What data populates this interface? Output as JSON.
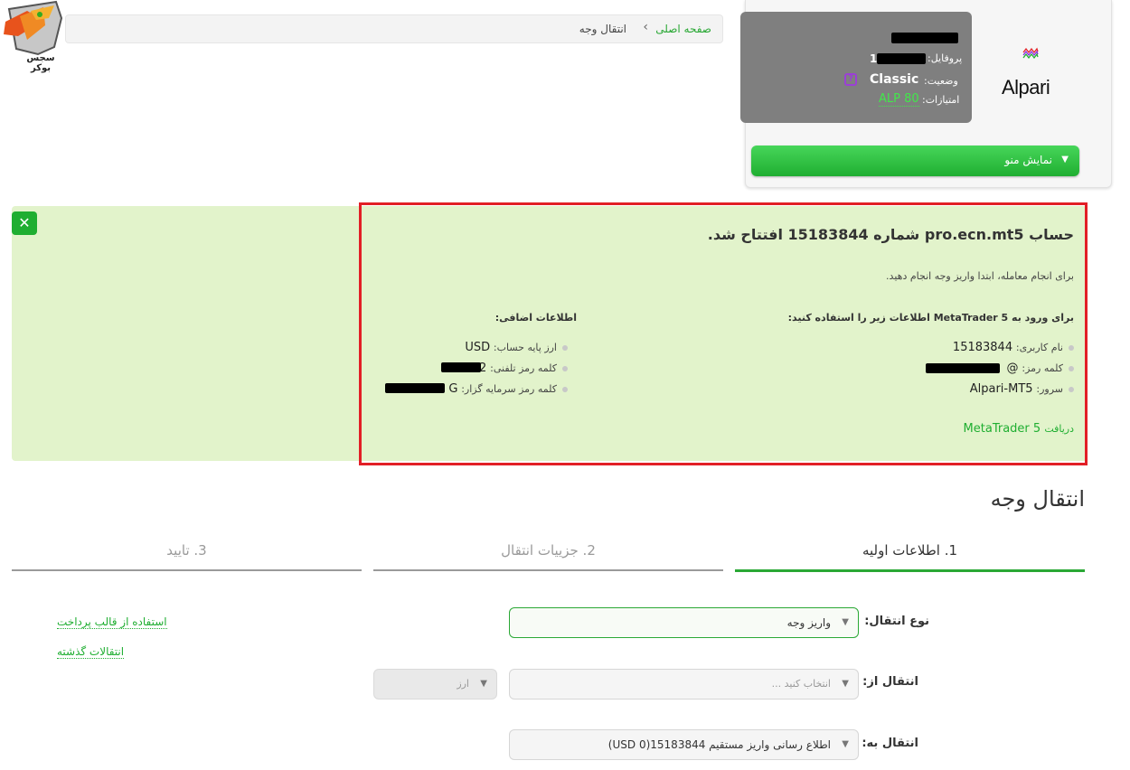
{
  "site": {
    "logo_text": "سجس بوکر"
  },
  "breadcrumb": {
    "home": "صفحه اصلی",
    "separator": "›",
    "current": "انتقال وجه"
  },
  "profile": {
    "profile_label": "پروفایل:",
    "profile_value_visible": "1",
    "status_label": "وضعیت:",
    "status_value": "Classic",
    "help_icon_glyph": "?",
    "points_label": "امتیازات:",
    "points_value": "ALP 80",
    "broker_name": "Alpari",
    "menu_label": "نمایش منو",
    "menu_arrow": "▼"
  },
  "alert": {
    "close_glyph": "✕",
    "title": "حساب pro.ecn.mt5 شماره 15183844 افتتاح شد.",
    "subtitle": "برای انجام معامله، ابتدا واریز وجه انجام دهید.",
    "left_heading": "برای ورود به MetaTrader 5 اطلاعات زیر را استفاده کنید:",
    "right_heading": "اطلاعات اضافی:",
    "login_items": [
      {
        "key": "نام کاربری:",
        "value": "15183844"
      },
      {
        "key": "کلمه رمز:",
        "value": "@"
      },
      {
        "key": "سرور:",
        "value": "Alpari-MT5"
      }
    ],
    "extra_items": [
      {
        "key": "ارز پایه حساب:",
        "value": "USD"
      },
      {
        "key": "کلمه رمز تلفنی:",
        "value": "42"
      },
      {
        "key": "کلمه رمز سرمایه گزار:",
        "value": "G"
      }
    ],
    "download_prefix": "دریافت",
    "download_name": "MetaTrader 5"
  },
  "page": {
    "heading": "انتقال وجه"
  },
  "steps": [
    {
      "label": "1. اطلاعات اولیه",
      "state": "active",
      "color": "#2aa835"
    },
    {
      "label": "2. جزییات انتقال",
      "state": "inactive",
      "color": "#9a9a9a"
    },
    {
      "label": "3. تایید",
      "state": "inactive",
      "color": "#9a9a9a"
    }
  ],
  "form": {
    "transfer_type_label": "نوع انتقال:",
    "transfer_type_value": "واریز وجه",
    "from_label": "انتقال از:",
    "from_placeholder": "انتخاب کنید ...",
    "currency_placeholder": "ارز",
    "to_label": "انتقال به:",
    "to_value": "اطلاع رسانی واریز مستقیم 15183844(0 USD)",
    "select_arrow": "▼"
  },
  "side_links": {
    "use_template": "استفاده از قالب پرداخت",
    "past_transfers": "انتقالات گذشته"
  },
  "colors": {
    "accent": "#1fae31",
    "alert_bg": "#e2f3cb",
    "alert_border": "#e21f26"
  }
}
